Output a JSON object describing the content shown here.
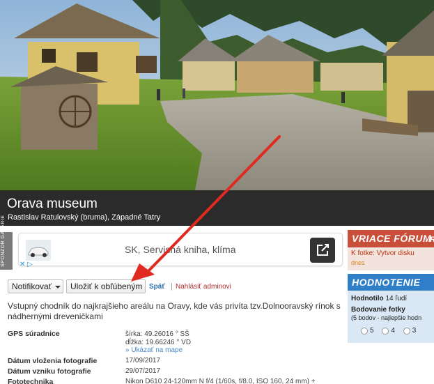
{
  "photo": {
    "title": "Orava museum",
    "subtitle": "Rastislav Ratulovský (bruma), Západné Tatry"
  },
  "ad": {
    "side_label": "SPONZOR GALERIE",
    "text": "SK, Servisná kniha, klíma",
    "marks": "✕ ▷"
  },
  "actions": {
    "notify_label": "Notifikovať",
    "save_favorite_label": "Uložiť k obľúbeným",
    "back_label": "Späť",
    "separator": "|",
    "report_label": "Nahlásiť adminovi"
  },
  "description": "Vstupný chodník do najkrajšieho areálu na Oravy, kde vás privíta tzv.Dolnooravský rínok s nádhernými dreveničkami",
  "info": {
    "gps_label": "GPS súradnice",
    "latitude": "šírka: 49.26016 ° SŠ",
    "longitude": "dĺžka: 19.66246 ° VD",
    "map_link": "» Ukázať na mape",
    "upload_label": "Dátum vloženia fotografie",
    "upload_value": "17/09/2017",
    "created_label": "Dátum vzniku fotografie",
    "created_value": "29/07/2017",
    "technique_label": "Fototechnika",
    "technique_value": "Nikon D610 24-120mm N f/4 (1/60s, f/8.0, ISO 160, 24 mm) +"
  },
  "sidebar": {
    "forum_title": "VRIACE FÓRUM",
    "forum_title_cut": "R",
    "forum_line": "K fotke: Vytvor disku",
    "forum_when": "dnes",
    "rating_title": "HODNOTENIE",
    "rated_label": "Hodnotilo",
    "rated_value": "14 ľudí",
    "scoring_label": "Bodovanie fotky",
    "scoring_hint": "(5 bodov - najlepšie hodn",
    "rating_options": [
      "5",
      "4",
      "3"
    ]
  },
  "colors": {
    "title_bar": "#2b2b2b",
    "forum_header": "#c8503a",
    "rating_header": "#2e7fc7",
    "annotation_arrow": "#e02a1f"
  }
}
